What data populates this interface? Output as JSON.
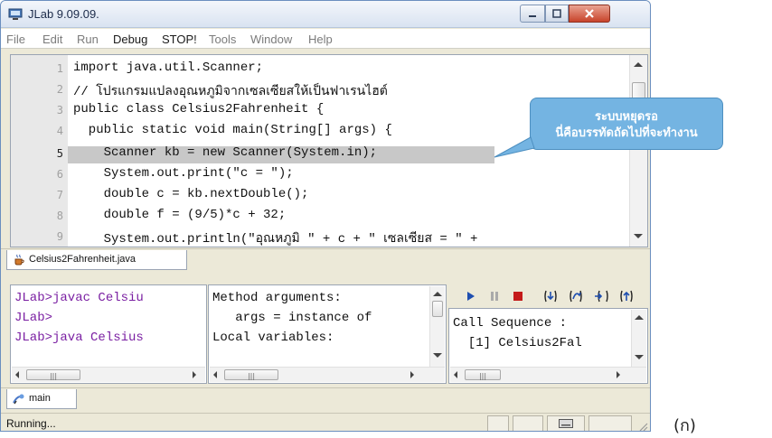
{
  "window": {
    "title": "JLab 9.09.09."
  },
  "menu": [
    {
      "label": "File",
      "enabled": false
    },
    {
      "label": "Edit",
      "enabled": false
    },
    {
      "label": "Run",
      "enabled": false
    },
    {
      "label": "Debug",
      "enabled": true
    },
    {
      "label": "STOP!",
      "enabled": true
    },
    {
      "label": "Tools",
      "enabled": false
    },
    {
      "label": "Window",
      "enabled": false
    },
    {
      "label": "Help",
      "enabled": false
    }
  ],
  "editor": {
    "current_line": 5,
    "lines": [
      {
        "n": "1",
        "code": "import java.util.Scanner;"
      },
      {
        "n": "2",
        "code": "// โปรแกรมแปลงอุณหภูมิจากเซลเซียสให้เป็นฟาเรนไฮต์"
      },
      {
        "n": "3",
        "code": "public class Celsius2Fahrenheit {"
      },
      {
        "n": "4",
        "code": "  public static void main(String[] args) {"
      },
      {
        "n": "5",
        "code": "    Scanner kb = new Scanner(System.in);"
      },
      {
        "n": "6",
        "code": "    System.out.print(\"c = \");"
      },
      {
        "n": "7",
        "code": "    double c = kb.nextDouble();"
      },
      {
        "n": "8",
        "code": "    double f = (9/5)*c + 32;"
      },
      {
        "n": "9",
        "code": "    System.out.println(\"อุณหภูมิ \" + c + \" เซลเซียส = \" +"
      }
    ]
  },
  "callout": {
    "line1": "ระบบหยุดรอ",
    "line2": "นี่คือบรรทัดถัดไปที่จะทำงาน",
    "color": "#74b4e2"
  },
  "file_tab": {
    "label": "Celsius2Fahrenheit.java"
  },
  "console": {
    "lines": [
      "JLab>javac Celsiu",
      "JLab>",
      "JLab>java Celsius"
    ]
  },
  "variables": {
    "lines": [
      "Method arguments:",
      "   args = instance of",
      "Local variables:"
    ]
  },
  "call_sequence": {
    "lines": [
      "Call Sequence :",
      "  [1] Celsius2Fal"
    ]
  },
  "debug_toolbar": {
    "buttons": [
      "run-icon",
      "pause-icon",
      "stop-icon",
      "step-into-icon",
      "step-over-icon",
      "step-out-icon",
      "step-return-icon"
    ]
  },
  "thread_tab": {
    "label": "main"
  },
  "status": {
    "text": "Running..."
  },
  "caption": "(ก)"
}
